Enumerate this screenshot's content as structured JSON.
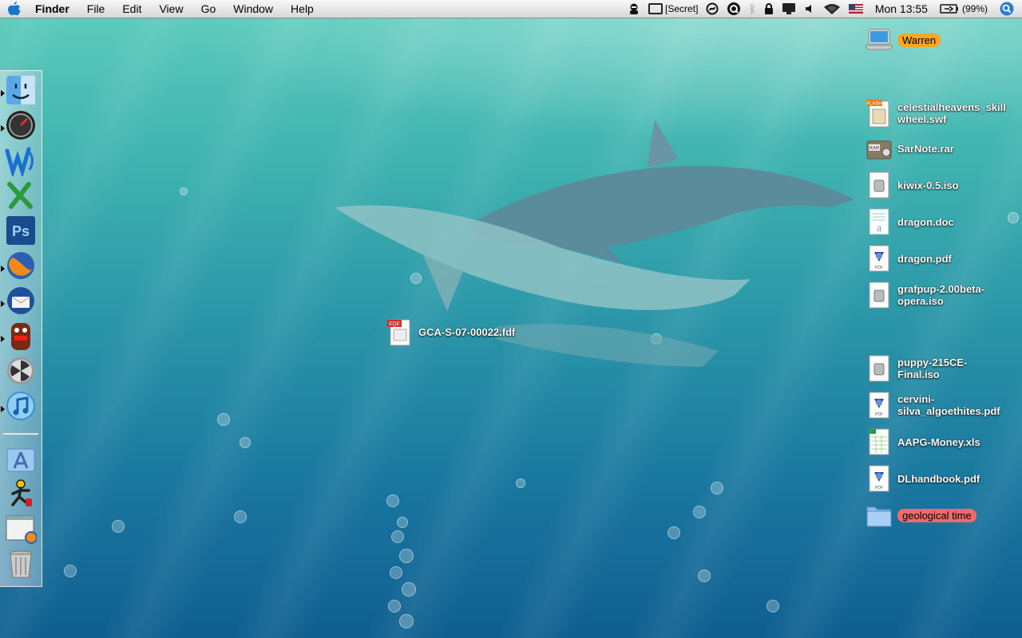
{
  "menubar": {
    "app_name": "Finder",
    "menus": [
      "File",
      "Edit",
      "View",
      "Go",
      "Window",
      "Help"
    ],
    "secret_label": "[Secret]",
    "clock": "Mon 13:55",
    "battery": "(99%)"
  },
  "desktop": {
    "floating_file": "GCA-S-07-00022.fdf",
    "drive_label": "Warren",
    "files": [
      {
        "name": "celestialheavens_skill\nwheel.swf",
        "kind": "flash"
      },
      {
        "name": "SarNote.rar",
        "kind": "rar"
      },
      {
        "name": "kiwix-0.5.iso",
        "kind": "iso"
      },
      {
        "name": "dragon.doc",
        "kind": "doc"
      },
      {
        "name": "dragon.pdf",
        "kind": "pdf"
      },
      {
        "name": "grafpup-2.00beta-\nopera.iso",
        "kind": "iso"
      },
      {
        "name": "puppy-215CE-\nFinal.iso",
        "kind": "iso"
      },
      {
        "name": "cervini-\nsilva_algoethites.pdf",
        "kind": "pdf"
      },
      {
        "name": "AAPG-Money.xls",
        "kind": "xls"
      },
      {
        "name": "DLhandbook.pdf",
        "kind": "pdf"
      }
    ],
    "folder_label": "geological time"
  },
  "dock": {
    "items": [
      "finder-icon",
      "dashboard-icon",
      "word-icon",
      "excel-icon",
      "photoshop-icon",
      "firefox-icon",
      "thunderbird-icon",
      "domo-icon",
      "burn-icon",
      "itunes-icon",
      "applications-stack-icon",
      "aim-icon",
      "screenshot-app-icon",
      "trash-icon"
    ]
  },
  "colors": {
    "warren_tag": "#f5a623",
    "geological_tag": "#f06a6a"
  }
}
